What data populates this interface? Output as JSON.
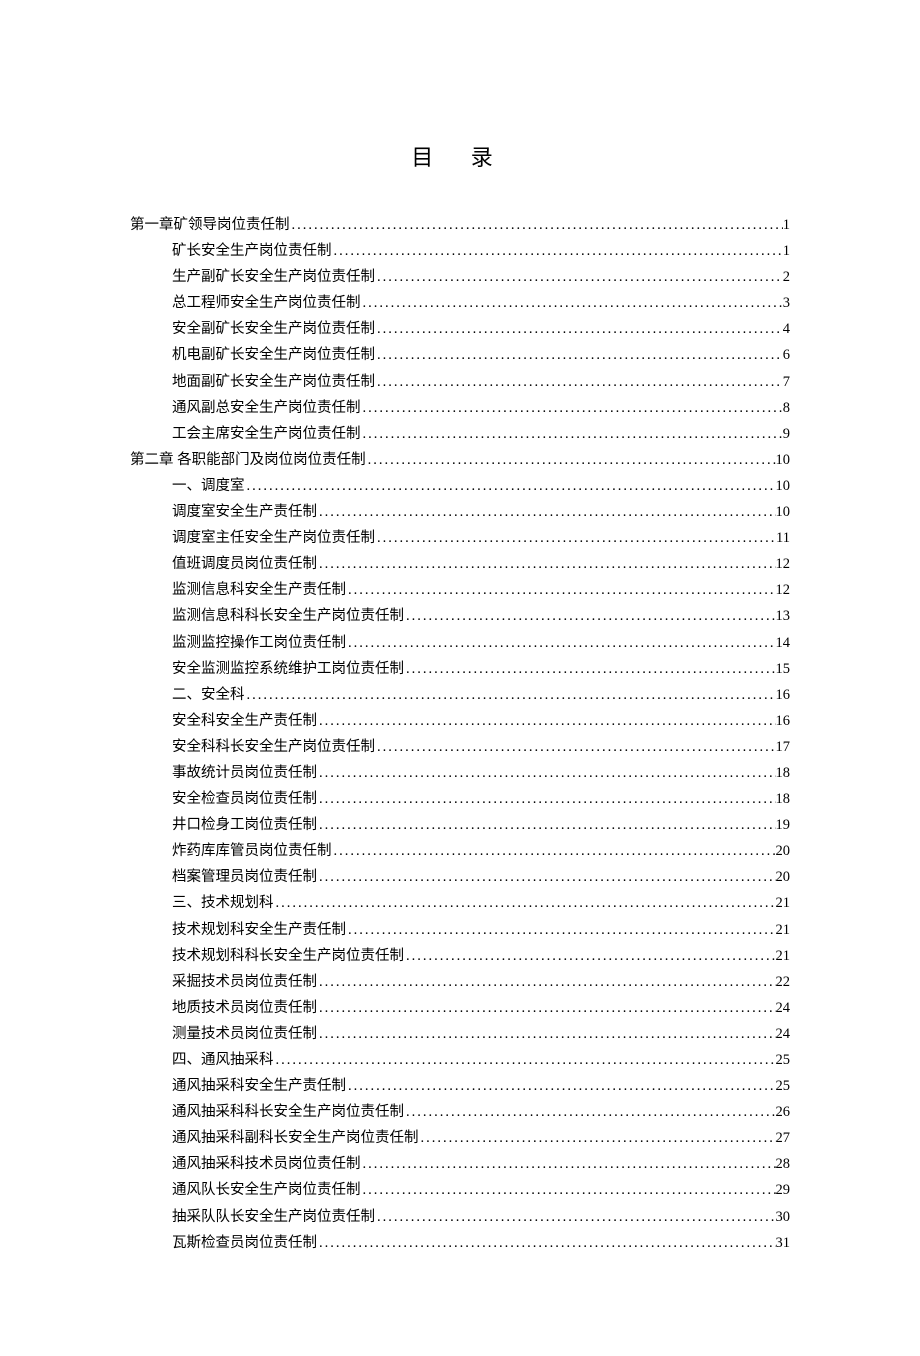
{
  "title": "目 录",
  "entries": [
    {
      "level": 1,
      "text": "第一章矿领导岗位责任制",
      "page": "1"
    },
    {
      "level": 2,
      "text": "矿长安全生产岗位责任制",
      "page": "1"
    },
    {
      "level": 2,
      "text": "生产副矿长安全生产岗位责任制",
      "page": "2"
    },
    {
      "level": 2,
      "text": "总工程师安全生产岗位责任制",
      "page": "3"
    },
    {
      "level": 2,
      "text": "安全副矿长安全生产岗位责任制",
      "page": "4"
    },
    {
      "level": 2,
      "text": "机电副矿长安全生产岗位责任制",
      "page": "6"
    },
    {
      "level": 2,
      "text": "地面副矿长安全生产岗位责任制",
      "page": "7"
    },
    {
      "level": 2,
      "text": "通风副总安全生产岗位责任制",
      "page": "8"
    },
    {
      "level": 2,
      "text": "工会主席安全生产岗位责任制",
      "page": "9"
    },
    {
      "level": 1,
      "text": "第二章  各职能部门及岗位岗位责任制",
      "page": "10"
    },
    {
      "level": 2,
      "text": "一、调度室",
      "page": "10"
    },
    {
      "level": 2,
      "text": "调度室安全生产责任制",
      "page": "10"
    },
    {
      "level": 2,
      "text": "调度室主任安全生产岗位责任制",
      "page": "11"
    },
    {
      "level": 2,
      "text": "值班调度员岗位责任制",
      "page": "12"
    },
    {
      "level": 2,
      "text": "监测信息科安全生产责任制",
      "page": "12"
    },
    {
      "level": 2,
      "text": "监测信息科科长安全生产岗位责任制",
      "page": "13"
    },
    {
      "level": 2,
      "text": "监测监控操作工岗位责任制",
      "page": "14"
    },
    {
      "level": 2,
      "text": "安全监测监控系统维护工岗位责任制",
      "page": "15"
    },
    {
      "level": 2,
      "text": "二、安全科",
      "page": "16"
    },
    {
      "level": 2,
      "text": "安全科安全生产责任制",
      "page": "16"
    },
    {
      "level": 2,
      "text": "安全科科长安全生产岗位责任制",
      "page": "17"
    },
    {
      "level": 2,
      "text": "事故统计员岗位责任制",
      "page": "18"
    },
    {
      "level": 2,
      "text": "安全检查员岗位责任制",
      "page": "18"
    },
    {
      "level": 2,
      "text": "井口检身工岗位责任制",
      "page": "19"
    },
    {
      "level": 2,
      "text": "炸药库库管员岗位责任制",
      "page": "20"
    },
    {
      "level": 2,
      "text": "档案管理员岗位责任制",
      "page": "20"
    },
    {
      "level": 2,
      "text": "三、技术规划科",
      "page": "21"
    },
    {
      "level": 2,
      "text": "技术规划科安全生产责任制",
      "page": "21"
    },
    {
      "level": 2,
      "text": "技术规划科科长安全生产岗位责任制",
      "page": "21"
    },
    {
      "level": 2,
      "text": "采掘技术员岗位责任制",
      "page": "22"
    },
    {
      "level": 2,
      "text": "地质技术员岗位责任制",
      "page": "24"
    },
    {
      "level": 2,
      "text": "测量技术员岗位责任制",
      "page": "24"
    },
    {
      "level": 2,
      "text": "四、通风抽采科",
      "page": "25"
    },
    {
      "level": 2,
      "text": "通风抽采科安全生产责任制",
      "page": "25"
    },
    {
      "level": 2,
      "text": "通风抽采科科长安全生产岗位责任制",
      "page": "26"
    },
    {
      "level": 2,
      "text": "通风抽采科副科长安全生产岗位责任制",
      "page": "27"
    },
    {
      "level": 2,
      "text": "通风抽采科技术员岗位责任制",
      "page": "28"
    },
    {
      "level": 2,
      "text": "通风队长安全生产岗位责任制",
      "page": "29"
    },
    {
      "level": 2,
      "text": "抽采队队长安全生产岗位责任制",
      "page": "30"
    },
    {
      "level": 2,
      "text": "瓦斯检查员岗位责任制",
      "page": "31"
    }
  ]
}
